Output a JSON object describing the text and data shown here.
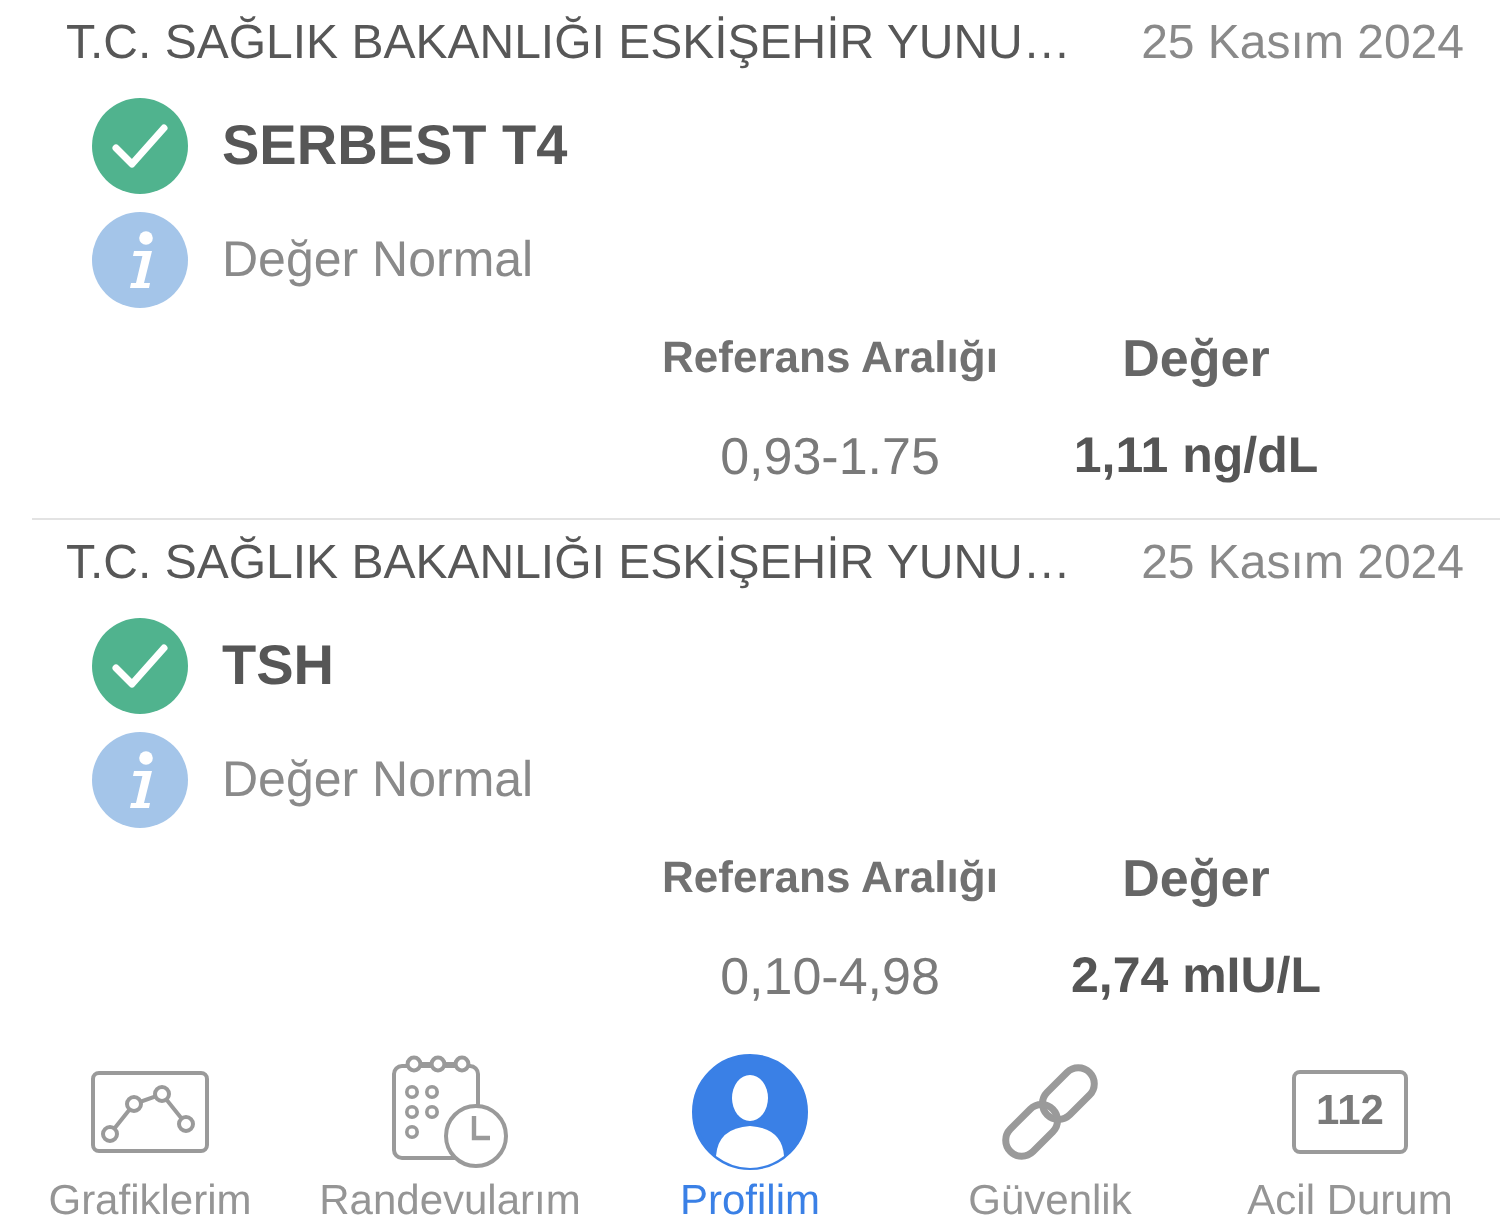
{
  "results": [
    {
      "source": "T.C. SAĞLIK BAKANLIĞI ESKİŞEHİR YUNU…",
      "date": "25 Kasım 2024",
      "test": "SERBEST T4",
      "status": "Değer Normal",
      "columns": [
        "Referans Aralığı",
        "Değer"
      ],
      "values": [
        "0,93-1.75",
        "1,11 ng/dL"
      ]
    },
    {
      "source": "T.C. SAĞLIK BAKANLIĞI ESKİŞEHİR YUNU…",
      "date": "25 Kasım 2024",
      "test": "TSH",
      "status": "Değer Normal",
      "columns": [
        "Referans Aralığı",
        "Değer"
      ],
      "values": [
        "0,10-4,98",
        "2,74 mIU/L"
      ]
    }
  ],
  "tabs": [
    {
      "label": "Grafiklerim",
      "selected": false
    },
    {
      "label": "Randevularım",
      "selected": false
    },
    {
      "label": "Profilim",
      "selected": true
    },
    {
      "label": "Güvenlik",
      "selected": false
    },
    {
      "label": "Acil Durum",
      "icon_text": "112",
      "selected": false
    }
  ]
}
